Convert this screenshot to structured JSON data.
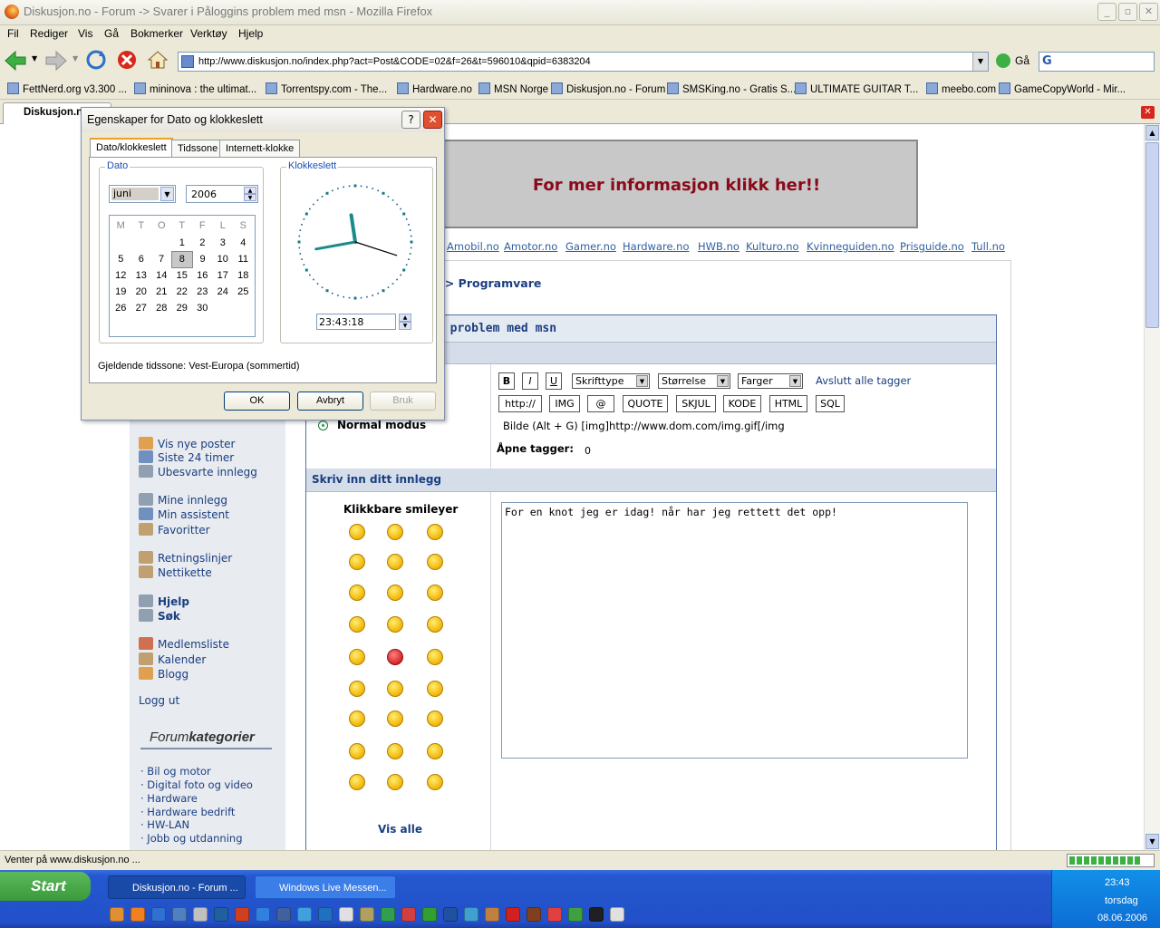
{
  "window": {
    "title": "Diskusjon.no - Forum -> Svarer i Påloggins problem med msn - Mozilla Firefox"
  },
  "menu": [
    "Fil",
    "Rediger",
    "Vis",
    "Gå",
    "Bokmerker",
    "Verktøy",
    "Hjelp"
  ],
  "nav": {
    "url": "http://www.diskusjon.no/index.php?act=Post&CODE=02&f=26&t=596010&qpid=6383204",
    "go_label": "Gå"
  },
  "bookmarks": [
    "FettNerd.org v3.300 ...",
    "mininova : the ultimat...",
    "Torrentspy.com - The...",
    "Hardware.no",
    "MSN Norge",
    "Diskusjon.no - Forum",
    "SMSKing.no - Gratis S...",
    "ULTIMATE GUITAR T...",
    "meebo.com",
    "GameCopyWorld - Mir..."
  ],
  "tab": {
    "label": "Diskusjon.n"
  },
  "status": {
    "text": "Venter på www.diskusjon.no ..."
  },
  "page": {
    "banner": "For mer informasjon klikk her!!",
    "sitelinks": [
      "Amobil.no",
      "Amotor.no",
      "Gamer.no",
      "Hardware.no",
      "HWB.no",
      "Kulturo.no",
      "Kvinneguiden.no",
      "Prisguide.no",
      "Tull.no"
    ],
    "breadcrumb": "e > Programvare",
    "topic_title": "s problem med msn",
    "sidebar": {
      "items": [
        "Vis nye poster",
        "Siste 24 timer",
        "Ubesvarte innlegg",
        "Mine innlegg",
        "Min assistent",
        "Favoritter",
        "Retningslinjer",
        "Nettikette",
        "Hjelp",
        "Søk",
        "Medlemsliste",
        "Kalender",
        "Blogg",
        "Logg ut"
      ],
      "forum_label_a": "Forum",
      "forum_label_b": "kategorier",
      "categories": [
        "· Bil og motor",
        "· Digital foto og video",
        "· Hardware",
        "· Hardware bedrift",
        "· HW-LAN",
        "· Jobb og utdanning"
      ]
    },
    "editor": {
      "btn_bold": "B",
      "btn_italic": "I",
      "btn_underline": "U",
      "font_select": "Skrifttype",
      "size_select": "Størrelse",
      "color_select": "Farger",
      "close_tags": "Avslutt alle tagger",
      "tag_buttons": [
        "http://",
        "IMG",
        "@",
        "QUOTE",
        "SKJUL",
        "KODE",
        "HTML",
        "SQL"
      ],
      "mode_label": "Normal modus",
      "hint": "Bilde (Alt + G) [img]http://www.dom.com/img.gif[/img",
      "open_tags_label": "Åpne tagger:",
      "open_tags_value": "0",
      "write_header": "Skriv inn ditt innlegg",
      "smileys_header": "Klikkbare smileyer",
      "see_all": "Vis alle",
      "post_text": "For en knot jeg er idag! når har jeg rettett det opp!"
    }
  },
  "dialog": {
    "title": "Egenskaper for Dato og klokkeslett",
    "tabs": [
      "Dato/klokkeslett",
      "Tidssone",
      "Internett-klokke"
    ],
    "date_group": "Dato",
    "month": "juni",
    "year": "2006",
    "weekdays": [
      "M",
      "T",
      "O",
      "T",
      "F",
      "L",
      "S"
    ],
    "weeks": [
      [
        "",
        "",
        "",
        "1",
        "2",
        "3",
        "4"
      ],
      [
        "5",
        "6",
        "7",
        "8",
        "9",
        "10",
        "11"
      ],
      [
        "12",
        "13",
        "14",
        "15",
        "16",
        "17",
        "18"
      ],
      [
        "19",
        "20",
        "21",
        "22",
        "23",
        "24",
        "25"
      ],
      [
        "26",
        "27",
        "28",
        "29",
        "30",
        "",
        ""
      ]
    ],
    "selected_day": "8",
    "time_group": "Klokkeslett",
    "time": "23:43:18",
    "timezone": "Gjeldende tidssone: Vest-Europa (sommertid)",
    "ok": "OK",
    "cancel": "Avbryt",
    "apply": "Bruk"
  },
  "taskbar": {
    "start": "Start",
    "tasks": [
      "Diskusjon.no - Forum ...",
      "Windows Live Messen..."
    ],
    "clock_time": "23:43",
    "clock_day": "torsdag",
    "clock_date": "08.06.2006"
  }
}
